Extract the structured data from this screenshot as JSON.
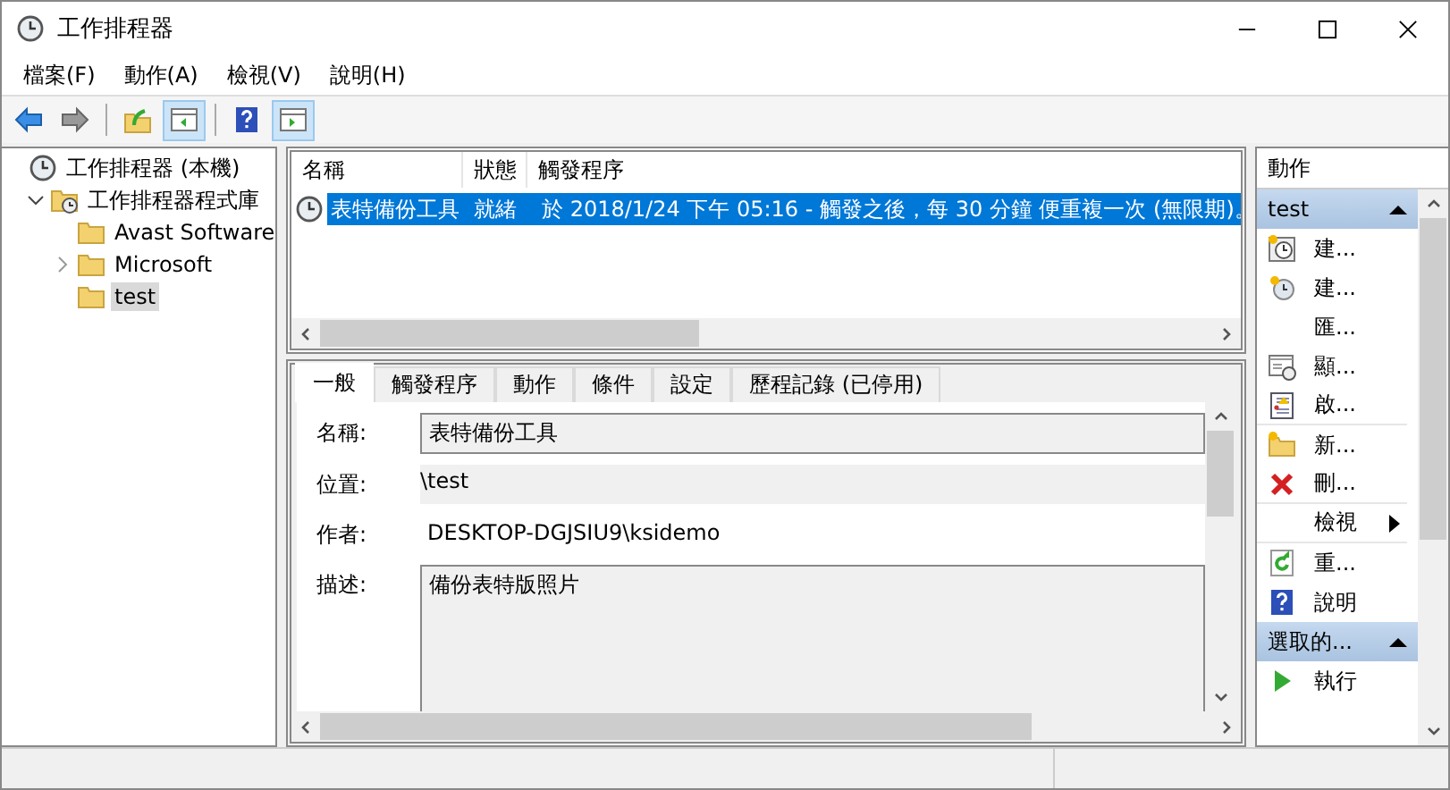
{
  "window": {
    "title": "工作排程器"
  },
  "menu": [
    "檔案(F)",
    "動作(A)",
    "檢視(V)",
    "說明(H)"
  ],
  "toolbar": [
    {
      "kind": "back",
      "pressed": false
    },
    {
      "kind": "forward",
      "pressed": false
    },
    {
      "kind": "up",
      "pressed": false
    },
    {
      "kind": "tree-pane",
      "pressed": true
    },
    {
      "kind": "help",
      "pressed": false
    },
    {
      "kind": "action-pane",
      "pressed": true
    }
  ],
  "tree": [
    {
      "label": "工作排程器 (本機)",
      "kind": "clock",
      "selected": false,
      "children": [
        {
          "label": "工作排程器程式庫",
          "kind": "clock-folder",
          "selected": false,
          "expanded": true,
          "children": [
            {
              "label": "Avast Software",
              "kind": "folder",
              "selected": false
            },
            {
              "label": "Microsoft",
              "kind": "folder",
              "selected": false,
              "expanded": false
            },
            {
              "label": "test",
              "kind": "folder",
              "selected": true
            }
          ]
        }
      ]
    }
  ],
  "task_list": {
    "columns": [
      "名稱",
      "狀態",
      "觸發程序"
    ],
    "rows": [
      {
        "selected": true,
        "cells": [
          "表特備份工具",
          "就緒",
          "於 2018/1/24 下午 05:16 - 觸發之後，每 30 分鐘 便重複一次 (無限期)。"
        ]
      }
    ]
  },
  "details": {
    "tabs": [
      {
        "label": "一般",
        "selected": true
      },
      {
        "label": "觸發程序",
        "selected": false
      },
      {
        "label": "動作",
        "selected": false
      },
      {
        "label": "條件",
        "selected": false
      },
      {
        "label": "設定",
        "selected": false
      },
      {
        "label": "歷程記錄 (已停用)",
        "selected": false
      }
    ],
    "fields": [
      {
        "label": "名稱:",
        "value": "表特備份工具",
        "kind": "box"
      },
      {
        "label": "位置:",
        "value": "\\test",
        "kind": "shaded"
      },
      {
        "label": "作者:",
        "value": "DESKTOP-DGJSIU9\\ksidemo",
        "kind": "plain"
      },
      {
        "label": "描述:",
        "value": "備份表特版照片",
        "kind": "area"
      }
    ]
  },
  "actions": {
    "title": "動作",
    "sections": [
      {
        "title": "test",
        "items": [
          {
            "label": "建...",
            "kind": "clock-star",
            "submenu": false,
            "divider_after": false
          },
          {
            "label": "建...",
            "kind": "clock",
            "submenu": false,
            "divider_after": false
          },
          {
            "label": "匯...",
            "kind": "plain",
            "submenu": false,
            "divider_after": false
          },
          {
            "label": "顯...",
            "kind": "window-clock",
            "submenu": false,
            "divider_after": false
          },
          {
            "label": "啟...",
            "kind": "log",
            "submenu": false,
            "divider_after": true
          },
          {
            "label": "新...",
            "kind": "folder",
            "submenu": false,
            "divider_after": false
          },
          {
            "label": "刪...",
            "kind": "delete",
            "submenu": false,
            "divider_after": true
          },
          {
            "label": "檢視",
            "kind": "plain",
            "submenu": true,
            "divider_after": true
          },
          {
            "label": "重...",
            "kind": "refresh",
            "submenu": false,
            "divider_after": false
          },
          {
            "label": "說明",
            "kind": "help",
            "submenu": false,
            "divider_after": false
          }
        ]
      },
      {
        "title": "選取的...",
        "items": [
          {
            "label": "執行",
            "kind": "run",
            "submenu": false,
            "divider_after": false
          }
        ]
      }
    ]
  }
}
